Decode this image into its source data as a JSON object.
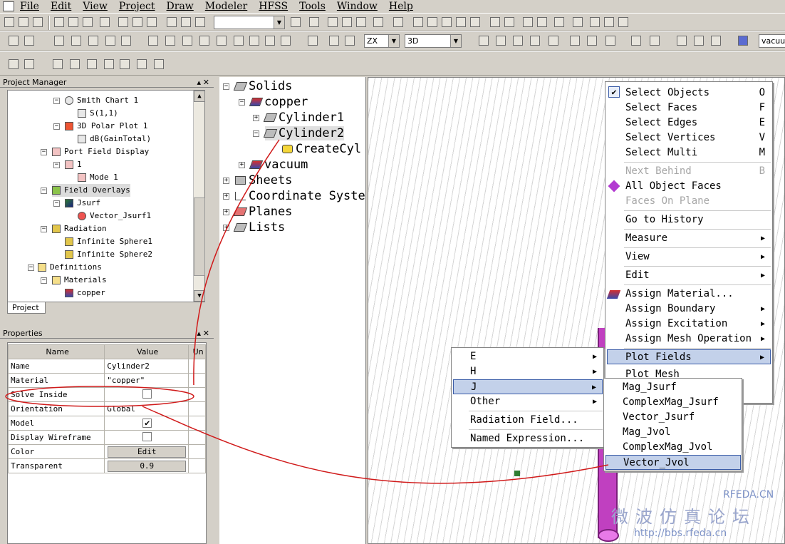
{
  "menubar": [
    "File",
    "Edit",
    "View",
    "Project",
    "Draw",
    "Modeler",
    "HFSS",
    "Tools",
    "Window",
    "Help"
  ],
  "toolbar": {
    "view_plane": "ZX",
    "view_mode": "3D",
    "material": "vacuum"
  },
  "project_manager": {
    "title": "Project Manager",
    "items": [
      {
        "label": "Smith Chart 1",
        "indent": 1
      },
      {
        "label": "S(1,1)",
        "indent": 2
      },
      {
        "label": "3D Polar Plot 1",
        "indent": 1
      },
      {
        "label": "dB(GainTotal)",
        "indent": 2
      },
      {
        "label": "Port Field Display",
        "indent": 0
      },
      {
        "label": "1",
        "indent": 1
      },
      {
        "label": "Mode 1",
        "indent": 2
      },
      {
        "label": "Field Overlays",
        "indent": 0
      },
      {
        "label": "Jsurf",
        "indent": 1
      },
      {
        "label": "Vector_Jsurf1",
        "indent": 2
      },
      {
        "label": "Radiation",
        "indent": 0
      },
      {
        "label": "Infinite Sphere1",
        "indent": 1
      },
      {
        "label": "Infinite Sphere2",
        "indent": 1
      },
      {
        "label": "Definitions",
        "indent": -1
      },
      {
        "label": "Materials",
        "indent": 0
      },
      {
        "label": "copper",
        "indent": 1
      }
    ],
    "tab": "Project"
  },
  "properties": {
    "title": "Properties",
    "headers": [
      "Name",
      "Value",
      "Un"
    ],
    "rows": [
      {
        "name": "Name",
        "value": "Cylinder2"
      },
      {
        "name": "Material",
        "value": "\"copper\""
      },
      {
        "name": "Solve Inside",
        "value": ""
      },
      {
        "name": "Orientation",
        "value": "Global"
      },
      {
        "name": "Model",
        "value": "✔"
      },
      {
        "name": "Display Wireframe",
        "value": ""
      },
      {
        "name": "Color",
        "value": "Edit"
      },
      {
        "name": "Transparent",
        "value": "0.9"
      }
    ]
  },
  "tree": {
    "items": [
      {
        "label": "Solids"
      },
      {
        "label": "copper"
      },
      {
        "label": "Cylinder1"
      },
      {
        "label": "Cylinder2"
      },
      {
        "label": "CreateCyl"
      },
      {
        "label": "vacuum"
      },
      {
        "label": "Sheets"
      },
      {
        "label": "Coordinate Syste"
      },
      {
        "label": "Planes"
      },
      {
        "label": "Lists"
      }
    ]
  },
  "context_menu": {
    "items": [
      {
        "label": "Select Objects",
        "acc": "O"
      },
      {
        "label": "Select Faces",
        "acc": "F"
      },
      {
        "label": "Select Edges",
        "acc": "E"
      },
      {
        "label": "Select Vertices",
        "acc": "V"
      },
      {
        "label": "Select Multi",
        "acc": "M"
      },
      {
        "label": "Next Behind",
        "acc": "B"
      },
      {
        "label": "All Object Faces"
      },
      {
        "label": "Faces On Plane"
      },
      {
        "label": "Go to History"
      },
      {
        "label": "Measure"
      },
      {
        "label": "View"
      },
      {
        "label": "Edit"
      },
      {
        "label": "Assign Material..."
      },
      {
        "label": "Assign Boundary"
      },
      {
        "label": "Assign Excitation"
      },
      {
        "label": "Assign Mesh Operation"
      },
      {
        "label": "Plot Fields"
      },
      {
        "label": "Plot Mesh"
      }
    ]
  },
  "field_menu": {
    "items": [
      "E",
      "H",
      "J",
      "Other",
      "Radiation Field...",
      "Named Expression..."
    ]
  },
  "j_menu": {
    "items": [
      "Mag_Jsurf",
      "ComplexMag_Jsurf",
      "Vector_Jsurf",
      "Mag_Jvol",
      "ComplexMag_Jvol",
      "Vector_Jvol"
    ]
  },
  "watermark": {
    "line1": "RFEDA.CN",
    "url": "http://bbs.rfeda.cn"
  }
}
